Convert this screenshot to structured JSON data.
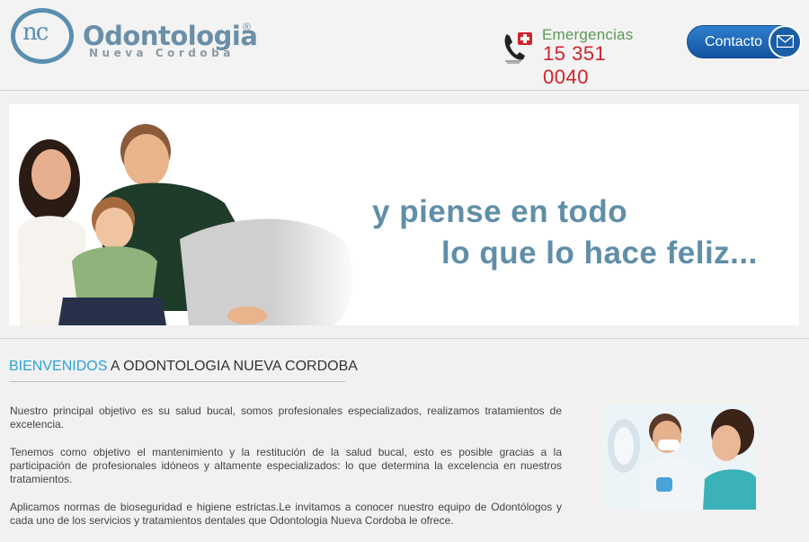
{
  "header": {
    "logo": {
      "monogram": "nc",
      "name": "Odontologia",
      "registered": "®",
      "subtitle": "Nueva Cordoba"
    },
    "emergency": {
      "label": "Emergencias",
      "number": "15 351 0040",
      "icon": "phone-emergency-icon"
    },
    "contact_button": {
      "label": "Contacto",
      "icon": "mail-icon"
    }
  },
  "banner": {
    "slogan_line1": "y piense en todo",
    "slogan_line2": "lo que lo hace feliz..."
  },
  "main": {
    "heading_accent": "BIENVENIDOS",
    "heading_rest": " A ODONTOLOGIA NUEVA CORDOBA",
    "paragraphs": [
      "Nuestro principal objetivo es su salud bucal, somos profesionales especializados, realizamos tratamientos de excelencia.",
      "Tenemos como objetivo el mantenimiento y la restitución de la salud bucal, esto es posible gracias a la participación de profesionales idóneos y altamente especializados: lo que determina la excelencia en nuestros tratamientos.",
      "Aplicamos normas de bioseguridad e higiene estrictas.Le invitamos a conocer nuestro equipo de Odontólogos y cada uno de los servicios y tratamientos dentales que Odontologia Nueva Cordoba le ofrece."
    ]
  },
  "colors": {
    "brand": "#5f8ea8",
    "accent": "#2ea3d8",
    "emergency_red": "#d2232a",
    "emergency_green": "#5b9a55",
    "button_blue": "#1a5ea8"
  }
}
